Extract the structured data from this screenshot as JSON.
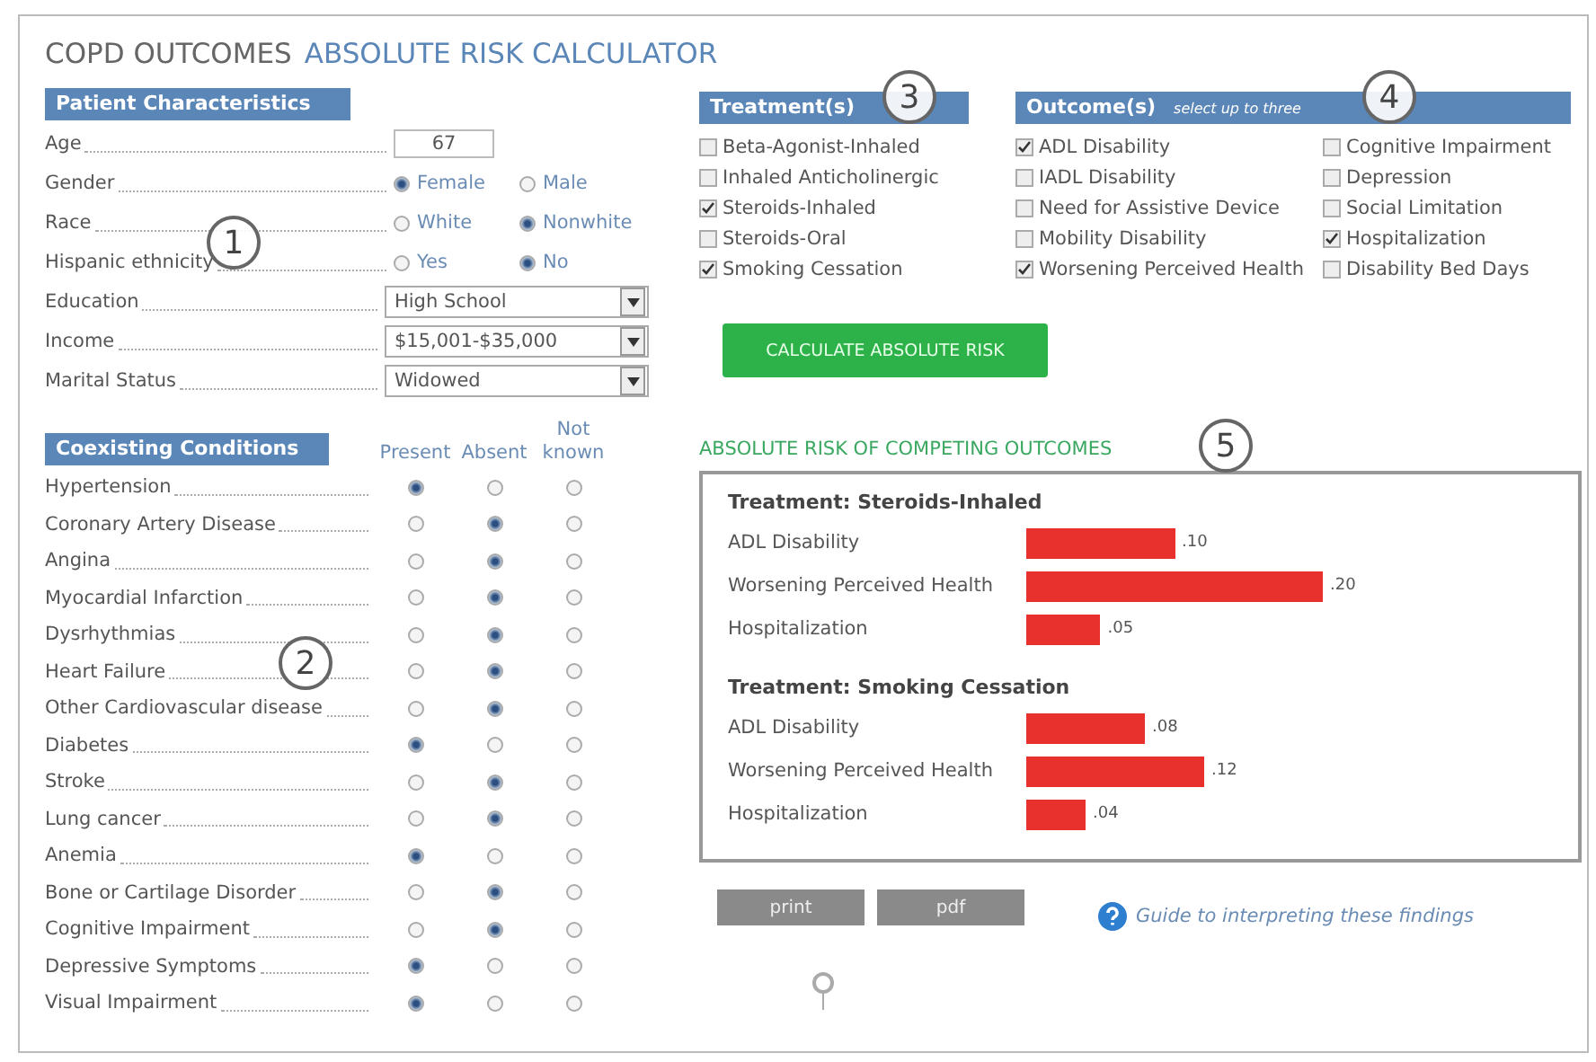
{
  "title": {
    "prefix": "COPD OUTCOMES",
    "main": "ABSOLUTE RISK CALCULATOR"
  },
  "patient": {
    "heading": "Patient Characteristics",
    "rows": [
      {
        "kind": "input",
        "label": "Age",
        "value": "67"
      },
      {
        "kind": "radio",
        "label": "Gender",
        "options": [
          {
            "label": "Female",
            "selected": true
          },
          {
            "label": "Male",
            "selected": false
          }
        ]
      },
      {
        "kind": "radio",
        "label": "Race",
        "options": [
          {
            "label": "White",
            "selected": false
          },
          {
            "label": "Nonwhite",
            "selected": true
          }
        ]
      },
      {
        "kind": "radio",
        "label": "Hispanic ethnicity",
        "options": [
          {
            "label": "Yes",
            "selected": false
          },
          {
            "label": "No",
            "selected": true
          }
        ]
      },
      {
        "kind": "select",
        "label": "Education",
        "value": "High School"
      },
      {
        "kind": "select",
        "label": "Income",
        "value": "$15,001-$35,000"
      },
      {
        "kind": "select",
        "label": "Marital Status",
        "value": "Widowed"
      }
    ]
  },
  "conditions": {
    "heading": "Coexisting Conditions",
    "columns": [
      "Present",
      "Absent",
      "Not known"
    ],
    "rows": [
      {
        "label": "Hypertension",
        "options": [
          {
            "selected": true
          },
          {
            "selected": false
          },
          {
            "selected": false
          }
        ]
      },
      {
        "label": "Coronary Artery Disease",
        "options": [
          {
            "selected": false
          },
          {
            "selected": true
          },
          {
            "selected": false
          }
        ]
      },
      {
        "label": "Angina",
        "options": [
          {
            "selected": false
          },
          {
            "selected": true
          },
          {
            "selected": false
          }
        ]
      },
      {
        "label": "Myocardial Infarction",
        "options": [
          {
            "selected": false
          },
          {
            "selected": true
          },
          {
            "selected": false
          }
        ]
      },
      {
        "label": "Dysrhythmias",
        "options": [
          {
            "selected": false
          },
          {
            "selected": true
          },
          {
            "selected": false
          }
        ]
      },
      {
        "label": "Heart Failure",
        "options": [
          {
            "selected": false
          },
          {
            "selected": true
          },
          {
            "selected": false
          }
        ]
      },
      {
        "label": "Other Cardiovascular disease",
        "options": [
          {
            "selected": false
          },
          {
            "selected": true
          },
          {
            "selected": false
          }
        ]
      },
      {
        "label": "Diabetes",
        "options": [
          {
            "selected": true
          },
          {
            "selected": false
          },
          {
            "selected": false
          }
        ]
      },
      {
        "label": "Stroke",
        "options": [
          {
            "selected": false
          },
          {
            "selected": true
          },
          {
            "selected": false
          }
        ]
      },
      {
        "label": "Lung cancer",
        "options": [
          {
            "selected": false
          },
          {
            "selected": true
          },
          {
            "selected": false
          }
        ]
      },
      {
        "label": "Anemia",
        "options": [
          {
            "selected": true
          },
          {
            "selected": false
          },
          {
            "selected": false
          }
        ]
      },
      {
        "label": "Bone or Cartilage Disorder",
        "options": [
          {
            "selected": false
          },
          {
            "selected": true
          },
          {
            "selected": false
          }
        ]
      },
      {
        "label": "Cognitive Impairment",
        "options": [
          {
            "selected": false
          },
          {
            "selected": true
          },
          {
            "selected": false
          }
        ]
      },
      {
        "label": "Depressive Symptoms",
        "options": [
          {
            "selected": true
          },
          {
            "selected": false
          },
          {
            "selected": false
          }
        ]
      },
      {
        "label": "Visual Impairment",
        "options": [
          {
            "selected": true
          },
          {
            "selected": false
          },
          {
            "selected": false
          }
        ]
      }
    ]
  },
  "treatments": {
    "heading": "Treatment(s)",
    "items": [
      {
        "label": "Beta-Agonist-Inhaled",
        "checked": false
      },
      {
        "label": "Inhaled Anticholinergic",
        "checked": false
      },
      {
        "label": "Steroids-Inhaled",
        "checked": true
      },
      {
        "label": "Steroids-Oral",
        "checked": false
      },
      {
        "label": "Smoking Cessation",
        "checked": true
      }
    ]
  },
  "outcomes": {
    "heading": "Outcome(s)",
    "hint": "select up to three",
    "items": [
      {
        "label": "ADL Disability",
        "checked": true
      },
      {
        "label": "IADL Disability",
        "checked": false
      },
      {
        "label": "Need for Assistive Device",
        "checked": false
      },
      {
        "label": "Mobility Disability",
        "checked": false
      },
      {
        "label": "Worsening Perceived Health",
        "checked": true
      },
      {
        "label": "Cognitive Impairment",
        "checked": false
      },
      {
        "label": "Depression",
        "checked": false
      },
      {
        "label": "Social Limitation",
        "checked": false
      },
      {
        "label": "Hospitalization",
        "checked": true
      },
      {
        "label": "Disability Bed Days",
        "checked": false
      }
    ]
  },
  "calculate_button": "CALCULATE ABSOLUTE RISK",
  "results": {
    "title": "ABSOLUTE RISK OF COMPETING OUTCOMES",
    "groups": [
      {
        "chart_data": {
          "type": "bar",
          "orientation": "horizontal",
          "title": "Treatment: Steroids-Inhaled",
          "categories": [
            "ADL Disability",
            "Worsening Perceived Health",
            "Hospitalization"
          ],
          "values": [
            0.1,
            0.2,
            0.05
          ],
          "data_labels": true,
          "value_labels": [
            ".10",
            ".20",
            ".05"
          ]
        }
      },
      {
        "chart_data": {
          "type": "bar",
          "orientation": "horizontal",
          "title": "Treatment: Smoking Cessation",
          "categories": [
            "ADL Disability",
            "Worsening Perceived Health",
            "Hospitalization"
          ],
          "values": [
            0.08,
            0.12,
            0.04
          ],
          "data_labels": true,
          "value_labels": [
            ".08",
            ".12",
            ".04"
          ]
        }
      }
    ]
  },
  "actions": [
    "print",
    "pdf"
  ],
  "guide_link": "Guide to interpreting these findings",
  "callouts": [
    "1",
    "2",
    "3",
    "4",
    "5"
  ]
}
